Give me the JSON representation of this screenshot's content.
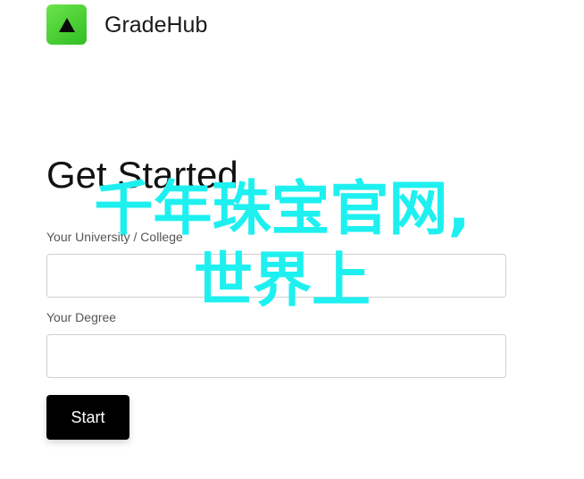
{
  "header": {
    "app_name": "GradeHub",
    "logo_icon": "triangle-up-icon",
    "logo_color": "#3cc92f"
  },
  "main": {
    "heading": "Get Started",
    "form": {
      "university": {
        "label": "Your University / College",
        "value": "",
        "placeholder": ""
      },
      "degree": {
        "label": "Your Degree",
        "value": "",
        "placeholder": ""
      },
      "submit_label": "Start"
    }
  },
  "watermark": {
    "line1": "千年珠宝官网,",
    "line2": "世界上",
    "color": "#1ef0f0"
  }
}
